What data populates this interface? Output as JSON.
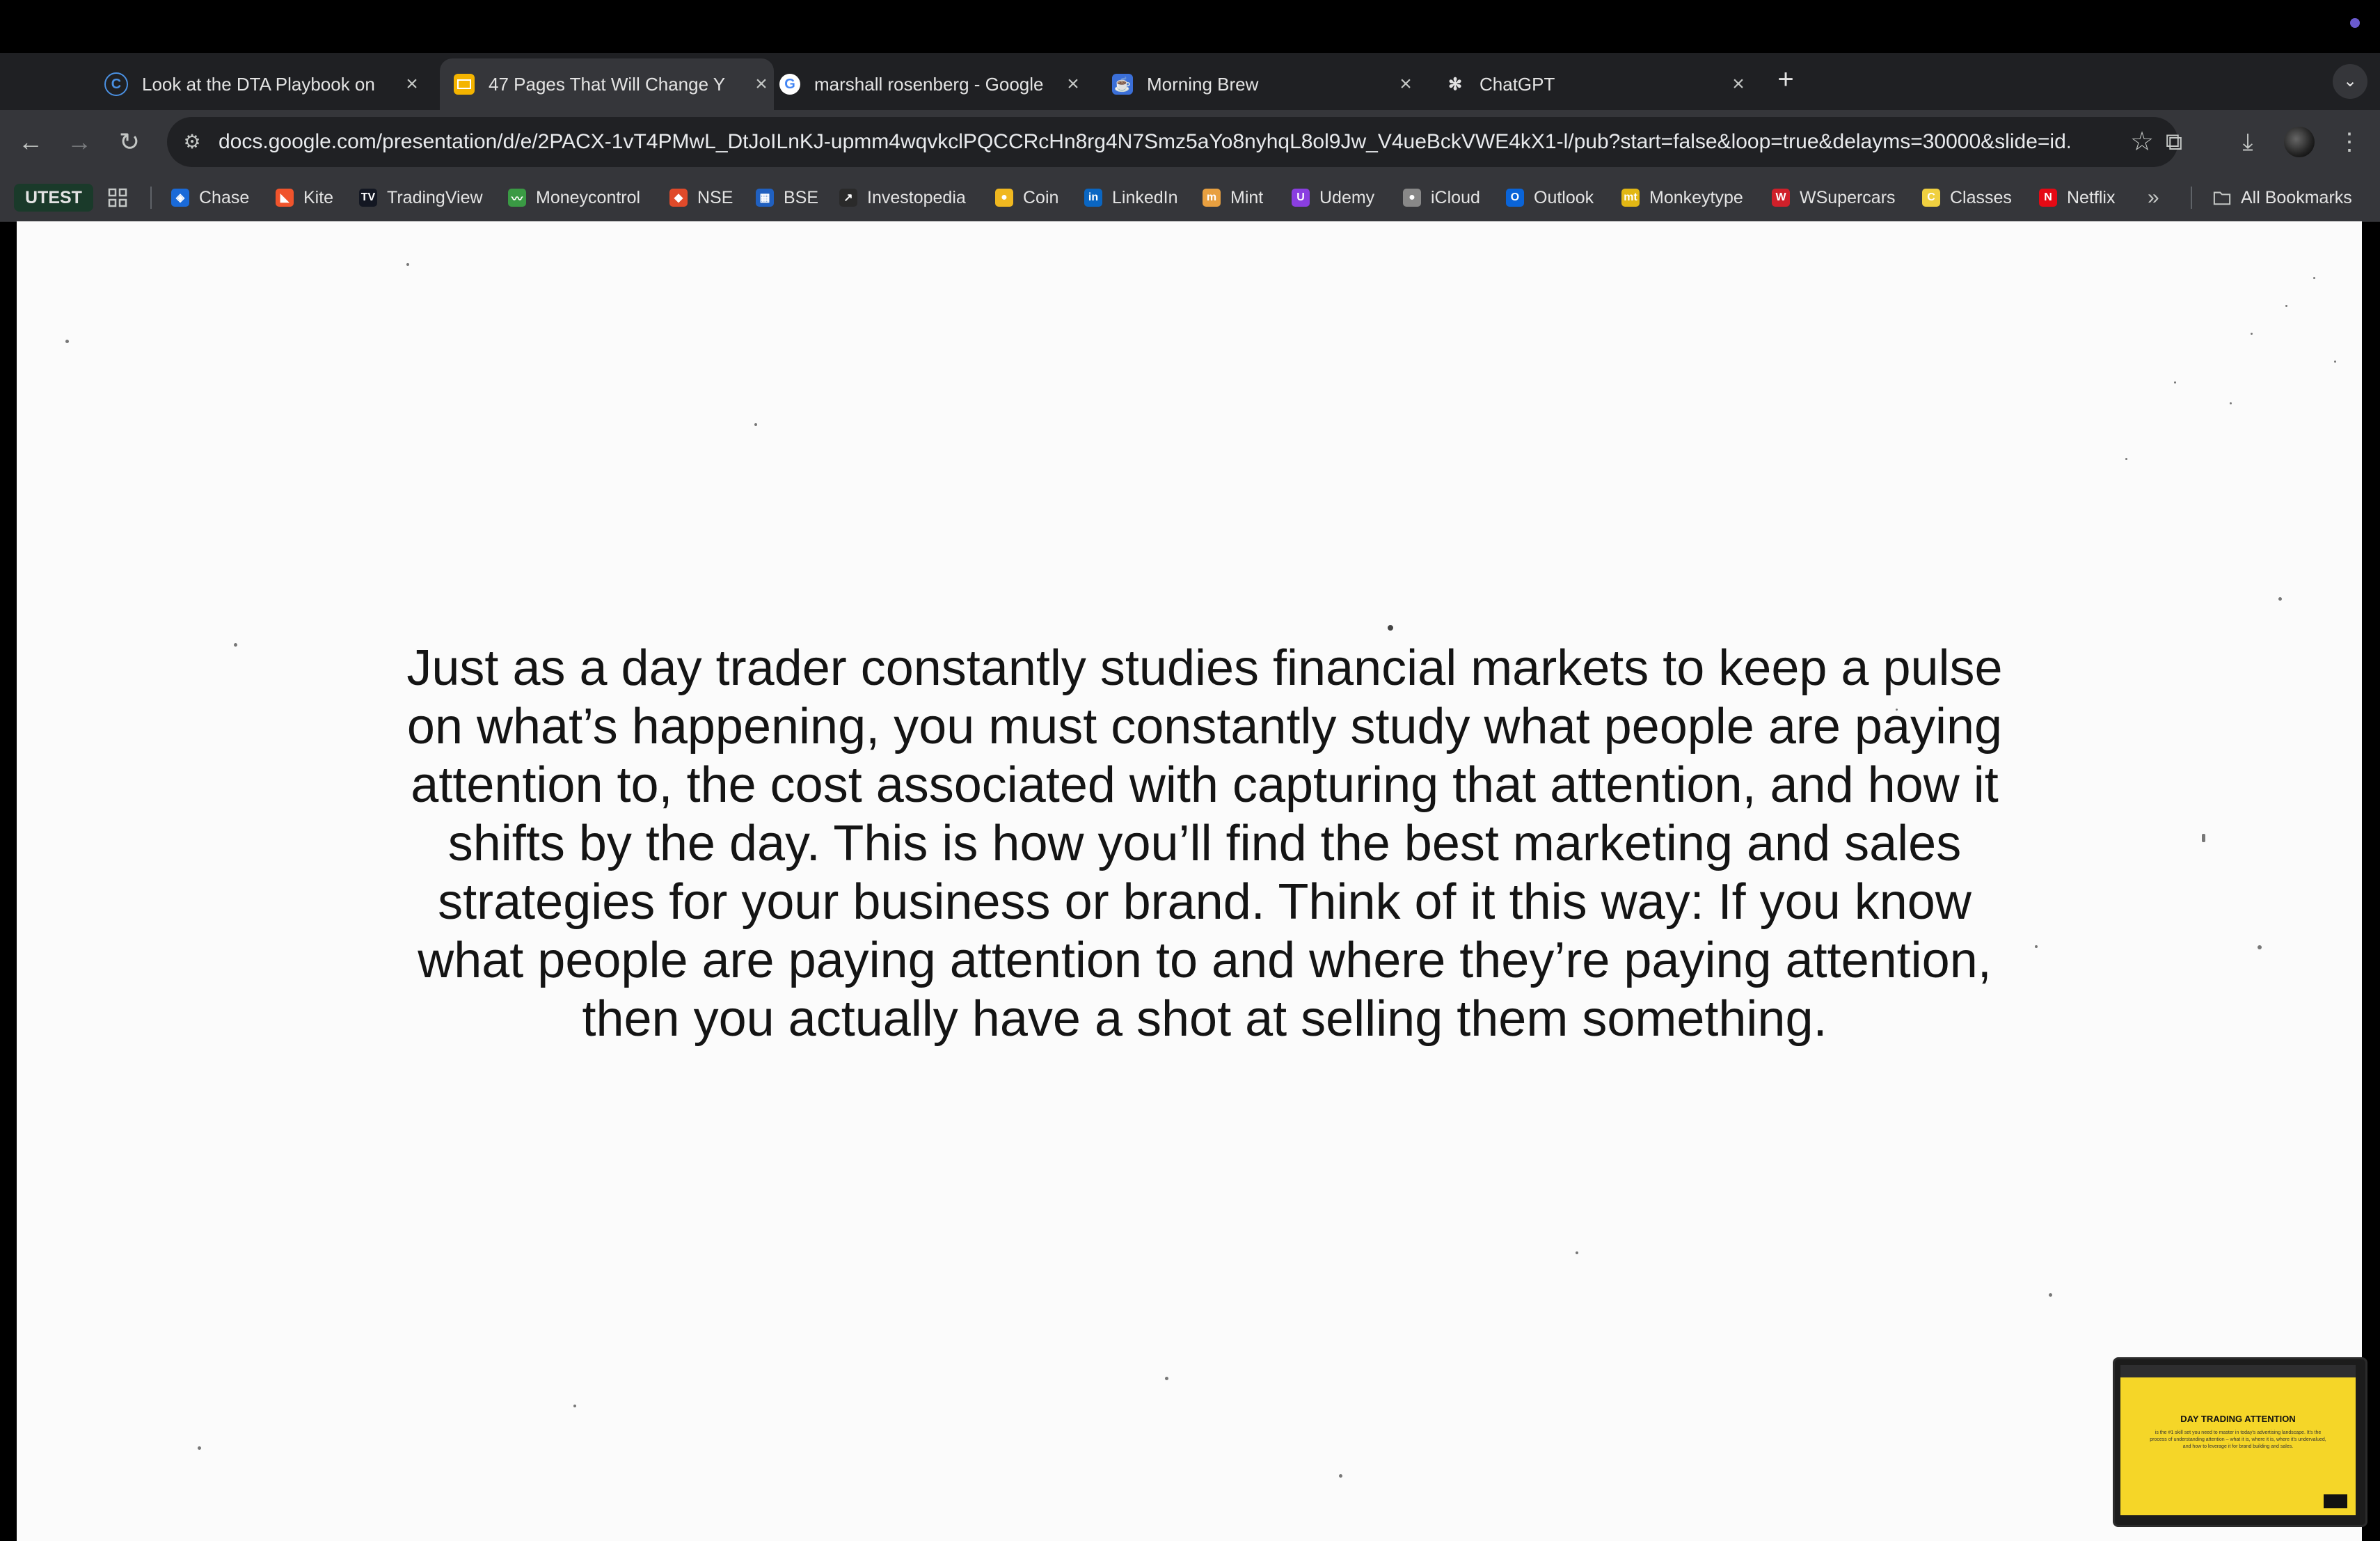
{
  "tabs": [
    {
      "title": "Look at the DTA Playbook on",
      "favicon": "C",
      "active": false
    },
    {
      "title": "47 Pages That Will Change Y",
      "favicon": "slides-icon",
      "active": true
    },
    {
      "title": "marshall rosenberg - Google",
      "favicon": "G",
      "active": false
    },
    {
      "title": "Morning Brew",
      "favicon": "morning-brew-icon",
      "active": false
    },
    {
      "title": "ChatGPT",
      "favicon": "chatgpt-icon",
      "active": false
    }
  ],
  "address_bar": {
    "url": "docs.google.com/presentation/d/e/2PACX-1vT4PMwL_DtJoILnKJ-upmm4wqvkclPQCCRcHn8rg4N7Smz5aYo8nyhqL8ol9Jw_V4ueBckVWE4kX1-l/pub?start=false&loop=true&delayms=30000&slide=id...."
  },
  "bookmarks": {
    "utest": "UTEST",
    "items": [
      {
        "label": "Chase",
        "color": "#1a6ad8"
      },
      {
        "label": "Kite",
        "color": "#f0542c"
      },
      {
        "label": "TradingView",
        "color": "#131722"
      },
      {
        "label": "Moneycontrol",
        "color": "#3a9a44"
      },
      {
        "label": "NSE",
        "color": "#e04a2a"
      },
      {
        "label": "BSE",
        "color": "#2060c0"
      },
      {
        "label": "Investopedia",
        "color": "#2a2a2a"
      },
      {
        "label": "Coin",
        "color": "#f0b820"
      },
      {
        "label": "LinkedIn",
        "color": "#0a66c2"
      },
      {
        "label": "Mint",
        "color": "#e8a040"
      },
      {
        "label": "Udemy",
        "color": "#8a3ee0"
      },
      {
        "label": "iCloud",
        "color": "#888888"
      },
      {
        "label": "Outlook",
        "color": "#0a64d8"
      },
      {
        "label": "Monkeytype",
        "color": "#e2b714"
      },
      {
        "label": "WSupercars",
        "color": "#d0202a"
      },
      {
        "label": "Classes",
        "color": "#f0d040"
      },
      {
        "label": "Netflix",
        "color": "#e50914"
      }
    ],
    "all_bookmarks": "All Bookmarks"
  },
  "slide": {
    "lines": [
      "Just as a day trader constantly studies financial markets to keep a pulse",
      "on what’s happening, you must constantly study what people are paying",
      "attention to, the cost associated with capturing that attention, and how it",
      "shifts by the day. This is how you’ll find the best marketing and sales",
      "strategies for your business or brand. Think of it this way: If you know",
      "what people are paying attention to and where they’re paying attention,",
      "then you actually have a shot at selling them something."
    ]
  },
  "thumbnail": {
    "title": "DAY TRADING ATTENTION",
    "body": "is the #1 skill set you need to master in today's advertising landscape. It's the process of understanding attention – what it is, where it is, where it's undervalued, and how to leverage it for brand building and sales."
  },
  "colors": {
    "tab_strip": "#1f2023",
    "toolbar": "#35363a",
    "page_background": "#fbfbfb",
    "thumbnail_accent": "#f5d628"
  }
}
